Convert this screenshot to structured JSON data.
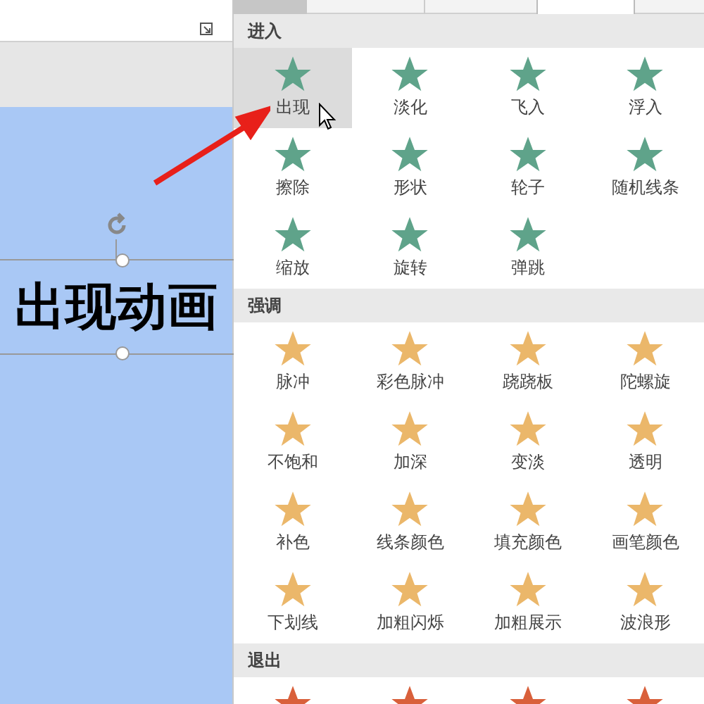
{
  "slide": {
    "text": "出现动画"
  },
  "sections": [
    {
      "title": "进入",
      "color": "#5fa38a",
      "items": [
        {
          "label": "出现",
          "selected": true
        },
        {
          "label": "淡化",
          "selected": false
        },
        {
          "label": "飞入",
          "selected": false
        },
        {
          "label": "浮入",
          "selected": false
        },
        {
          "label": "擦除",
          "selected": false
        },
        {
          "label": "形状",
          "selected": false
        },
        {
          "label": "轮子",
          "selected": false
        },
        {
          "label": "随机线条",
          "selected": false
        },
        {
          "label": "缩放",
          "selected": false
        },
        {
          "label": "旋转",
          "selected": false
        },
        {
          "label": "弹跳",
          "selected": false
        }
      ]
    },
    {
      "title": "强调",
      "color": "#ebb76a",
      "items": [
        {
          "label": "脉冲",
          "selected": false
        },
        {
          "label": "彩色脉冲",
          "selected": false
        },
        {
          "label": "跷跷板",
          "selected": false
        },
        {
          "label": "陀螺旋",
          "selected": false
        },
        {
          "label": "不饱和",
          "selected": false
        },
        {
          "label": "加深",
          "selected": false
        },
        {
          "label": "变淡",
          "selected": false
        },
        {
          "label": "透明",
          "selected": false
        },
        {
          "label": "补色",
          "selected": false
        },
        {
          "label": "线条颜色",
          "selected": false
        },
        {
          "label": "填充颜色",
          "selected": false
        },
        {
          "label": "画笔颜色",
          "selected": false
        },
        {
          "label": "下划线",
          "selected": false
        },
        {
          "label": "加粗闪烁",
          "selected": false
        },
        {
          "label": "加粗展示",
          "selected": false
        },
        {
          "label": "波浪形",
          "selected": false
        }
      ]
    },
    {
      "title": "退出",
      "color": "#d9603b",
      "items": [
        {
          "selected": false
        },
        {
          "selected": false
        },
        {
          "selected": false
        },
        {
          "selected": false
        }
      ]
    }
  ]
}
